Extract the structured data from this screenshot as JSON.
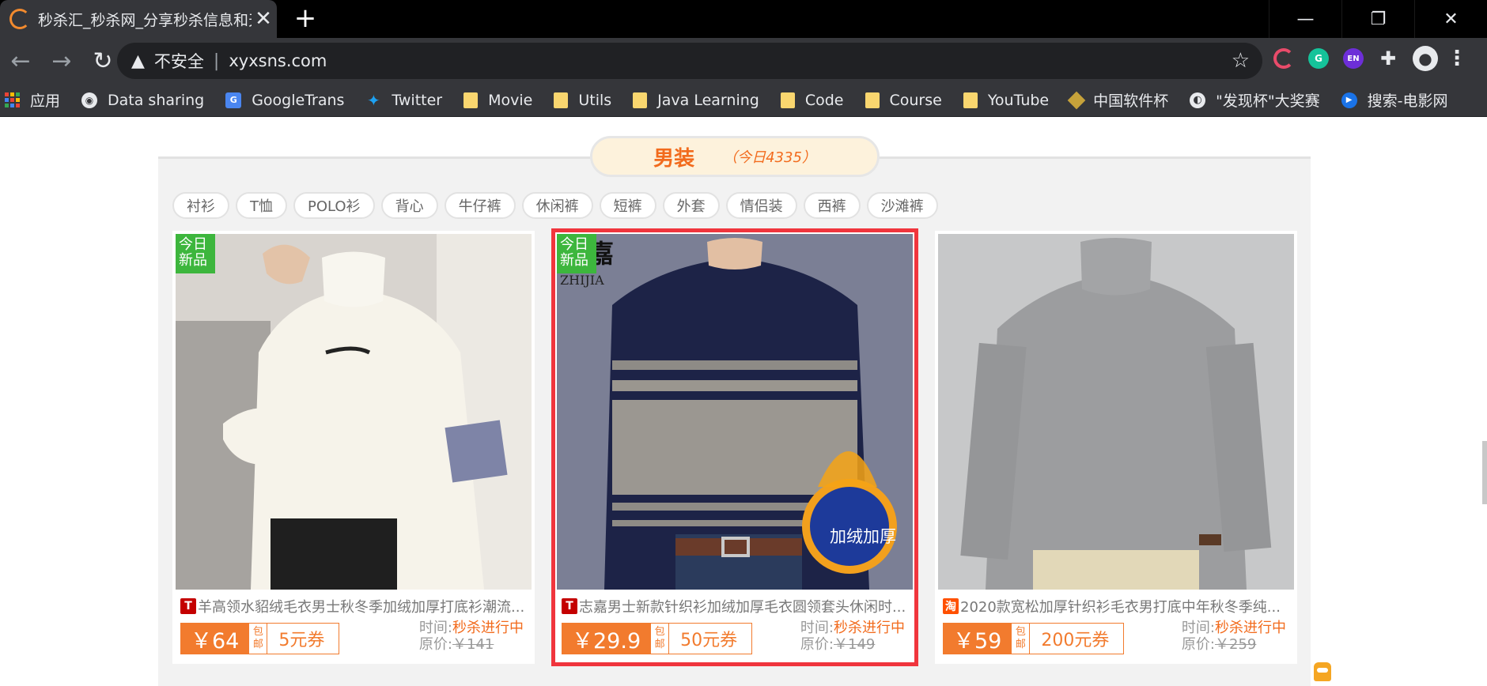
{
  "browser": {
    "tab_title": "秒杀汇_秒杀网_分享秒杀信息和天",
    "tab_close": "✕",
    "new_tab": "+",
    "win_minimize": "—",
    "win_restore": "❐",
    "win_close": "✕",
    "nav_back": "←",
    "nav_forward": "→",
    "nav_reload": "↻",
    "insecure_icon": "▲",
    "insecure_label": "不安全",
    "separator": "|",
    "url": "xyxsns.com",
    "star": "☆",
    "extensions": {
      "grammarly": "G",
      "lang": "EN",
      "puzzle": "✚",
      "avatar": "●",
      "menu": "⋮"
    }
  },
  "bookmarks": [
    {
      "label": "应用",
      "icon": "apps-icon"
    },
    {
      "label": "Data sharing",
      "icon": "github-icon"
    },
    {
      "label": "GoogleTrans",
      "icon": "google-translate-icon"
    },
    {
      "label": "Twitter",
      "icon": "twitter-icon"
    },
    {
      "label": "Movie",
      "icon": "folder-icon"
    },
    {
      "label": "Utils",
      "icon": "folder-icon"
    },
    {
      "label": "Java Learning",
      "icon": "folder-icon"
    },
    {
      "label": "Code",
      "icon": "folder-icon"
    },
    {
      "label": "Course",
      "icon": "folder-icon"
    },
    {
      "label": "YouTube",
      "icon": "folder-icon"
    },
    {
      "label": "中国软件杯",
      "icon": "cube-icon"
    },
    {
      "label": "\"发现杯\"大奖赛",
      "icon": "globe-icon"
    },
    {
      "label": "搜索-电影网",
      "icon": "play-icon"
    }
  ],
  "section": {
    "title": "男装",
    "count": "（今日4335）"
  },
  "filters": [
    "衬衫",
    "T恤",
    "POLO衫",
    "背心",
    "牛仔裤",
    "休闲裤",
    "短裤",
    "外套",
    "情侣装",
    "西裤",
    "沙滩裤"
  ],
  "products": [
    {
      "badge": "今日\n新品",
      "platform": "T",
      "title": "羊高领水貂绒毛衣男士秋冬季加绒加厚打底衫潮流...",
      "price": "￥64",
      "shipping": "包\n邮",
      "coupon": "5元券",
      "time_label": "时间:",
      "time_value": "秒杀进行中",
      "orig_label": "原价:",
      "orig_price": "￥141"
    },
    {
      "badge": "今日\n新品",
      "platform": "T",
      "title": "志嘉男士新款针织衫加绒加厚毛衣圆领套头休闲时...",
      "price": "￥29.9",
      "shipping": "包\n邮",
      "coupon": "50元券",
      "time_label": "时间:",
      "time_value": "秒杀进行中",
      "orig_label": "原价:",
      "orig_price": "￥149",
      "brand_mark": "嘉",
      "brand_text": "ZHIJIA",
      "overlay_text": "加绒加厚"
    },
    {
      "platform": "淘",
      "title": "2020款宽松加厚针织衫毛衣男打底中年秋冬季纯...",
      "price": "￥59",
      "shipping": "包\n邮",
      "coupon": "200元券",
      "time_label": "时间:",
      "time_value": "秒杀进行中",
      "orig_label": "原价:",
      "orig_price": "￥259"
    }
  ],
  "colors": {
    "accent": "#f27b2e",
    "selected_outline": "#f0353d",
    "badge_green": "#3db63d"
  }
}
